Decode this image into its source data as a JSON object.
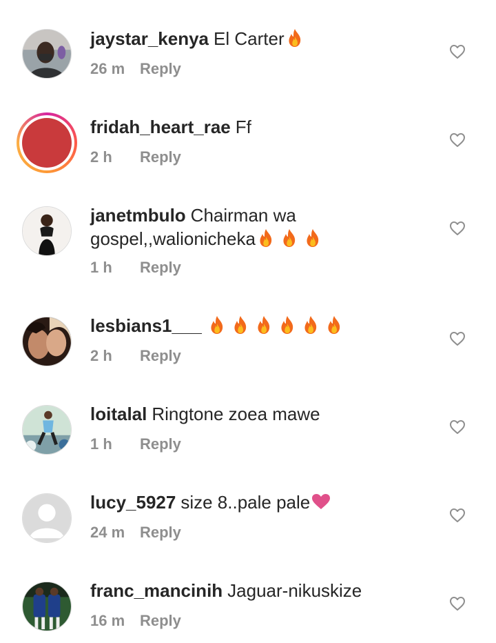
{
  "comments": [
    {
      "username": "jaystar_kenya",
      "text": "El Carter",
      "fires": 1,
      "heart": false,
      "time": "26 m",
      "reply": "Reply",
      "avatar": "photo-man"
    },
    {
      "username": "fridah_heart_rae",
      "text": "Ff",
      "fires": 0,
      "heart": false,
      "time": "2 h",
      "reply": "Reply",
      "avatar": "story-red"
    },
    {
      "username": "janetmbulo",
      "text": "Chairman wa",
      "text2": "gospel,,walionicheka",
      "fires": 3,
      "heart": false,
      "time": "1 h",
      "reply": "Reply",
      "avatar": "photo-woman"
    },
    {
      "username": "lesbians1___",
      "text": "",
      "fires": 6,
      "heart": false,
      "time": "2 h",
      "reply": "Reply",
      "avatar": "photo-couple"
    },
    {
      "username": "loitalal",
      "text": "Ringtone zoea mawe",
      "fires": 0,
      "heart": false,
      "time": "1 h",
      "reply": "Reply",
      "avatar": "photo-figure"
    },
    {
      "username": "lucy_5927",
      "text": "size 8..pale pale",
      "fires": 0,
      "heart": true,
      "time": "24 m",
      "reply": "Reply",
      "avatar": "default-user"
    },
    {
      "username": "franc_mancinih",
      "text": "Jaguar-nikuskize",
      "fires": 0,
      "heart": false,
      "time": "16 m",
      "reply": "Reply",
      "avatar": "photo-players"
    }
  ],
  "icons": {
    "like": "heart-outline-icon",
    "fire": "fire-emoji",
    "heart": "pink-heart-emoji"
  },
  "colors": {
    "text": "#262626",
    "meta": "#8e8e8e",
    "heart_emoji": "#e0508a",
    "ring": "#fd5949"
  }
}
